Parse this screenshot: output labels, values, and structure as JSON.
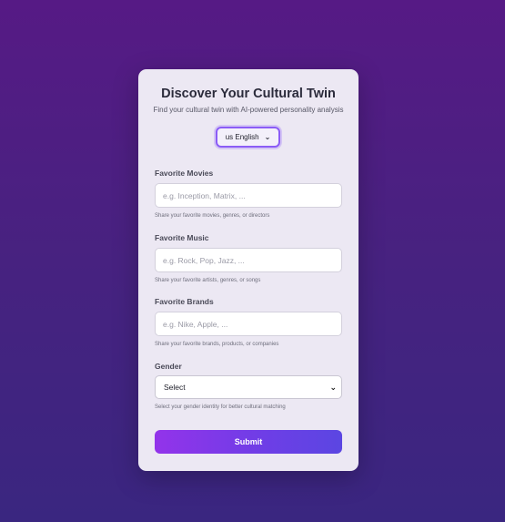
{
  "form": {
    "title": "Discover Your Cultural Twin",
    "subtitle": "Find your cultural twin with AI-powered personality analysis",
    "language": {
      "flag": "us",
      "label": "English",
      "display": "us English"
    },
    "fields": {
      "movies": {
        "label": "Favorite Movies",
        "placeholder": "e.g. Inception, Matrix, ...",
        "help": "Share your favorite movies, genres, or directors"
      },
      "music": {
        "label": "Favorite Music",
        "placeholder": "e.g. Rock, Pop, Jazz, ...",
        "help": "Share your favorite artists, genres, or songs"
      },
      "brands": {
        "label": "Favorite Brands",
        "placeholder": "e.g. Nike, Apple, ...",
        "help": "Share your favorite brands, products, or companies"
      },
      "gender": {
        "label": "Gender",
        "selected": "Select",
        "help": "Select your gender identity for better cultural matching"
      }
    },
    "submit_label": "Submit"
  },
  "colors": {
    "background_top": "#561a85",
    "background_bottom": "#3a2680",
    "card": "#ece8f3",
    "accent": "#8b5cf6",
    "button_start": "#9333ea",
    "button_end": "#5b46e2"
  },
  "icons": {
    "dropdown": "chevron-down-icon"
  }
}
